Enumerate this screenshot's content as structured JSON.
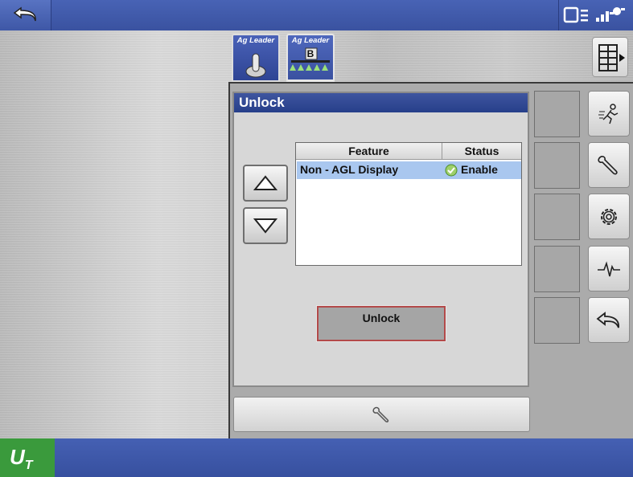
{
  "topbar": {
    "back_icon": "undo-arrow-icon",
    "status_icons": [
      "display-status-icon",
      "gps-signal-icon"
    ]
  },
  "tabs": [
    {
      "label": "Ag Leader",
      "icon": "joystick-icon"
    },
    {
      "label": "Ag Leader",
      "badge": "B",
      "icon": "boom-sprayer-icon"
    }
  ],
  "dialog": {
    "title": "Unlock",
    "table": {
      "headers": {
        "feature": "Feature",
        "status": "Status"
      },
      "rows": [
        {
          "feature": "Non - AGL Display",
          "status": "Enable",
          "status_icon": "check-circle-icon"
        }
      ]
    },
    "unlock_label": "Unlock"
  },
  "sidebar": [
    "run-icon",
    "wrench-icon",
    "gear-icon",
    "diagnostic-wave-icon",
    "back-arrow-icon"
  ],
  "bottombar": {
    "ut_main": "U",
    "ut_sub": "T"
  },
  "colors": {
    "accent_blue": "#3b4f96",
    "selected_row": "#a9c7ef",
    "ut_green": "#3a9a3c",
    "unlock_border": "#b34a4a"
  }
}
